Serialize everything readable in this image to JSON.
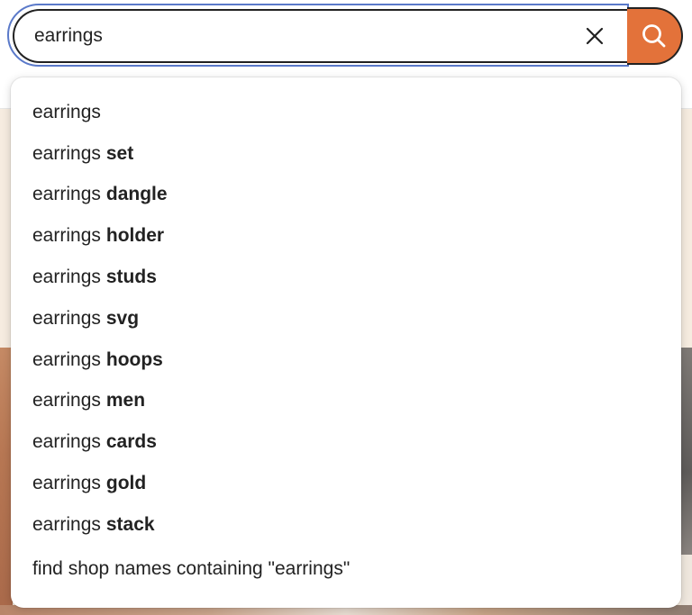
{
  "search": {
    "value": "earrings",
    "clear_icon": "close-icon",
    "submit_icon": "search-icon",
    "accent_color": "#e3723a",
    "focus_color": "#5a79c9"
  },
  "suggestions": [
    {
      "prefix": "earrings",
      "suffix": ""
    },
    {
      "prefix": "earrings",
      "suffix": "set"
    },
    {
      "prefix": "earrings",
      "suffix": "dangle"
    },
    {
      "prefix": "earrings",
      "suffix": "holder"
    },
    {
      "prefix": "earrings",
      "suffix": "studs"
    },
    {
      "prefix": "earrings",
      "suffix": "svg"
    },
    {
      "prefix": "earrings",
      "suffix": "hoops"
    },
    {
      "prefix": "earrings",
      "suffix": "men"
    },
    {
      "prefix": "earrings",
      "suffix": "cards"
    },
    {
      "prefix": "earrings",
      "suffix": "gold"
    },
    {
      "prefix": "earrings",
      "suffix": "stack"
    }
  ],
  "shop_search": {
    "label": "find shop names containing \"earrings\""
  }
}
